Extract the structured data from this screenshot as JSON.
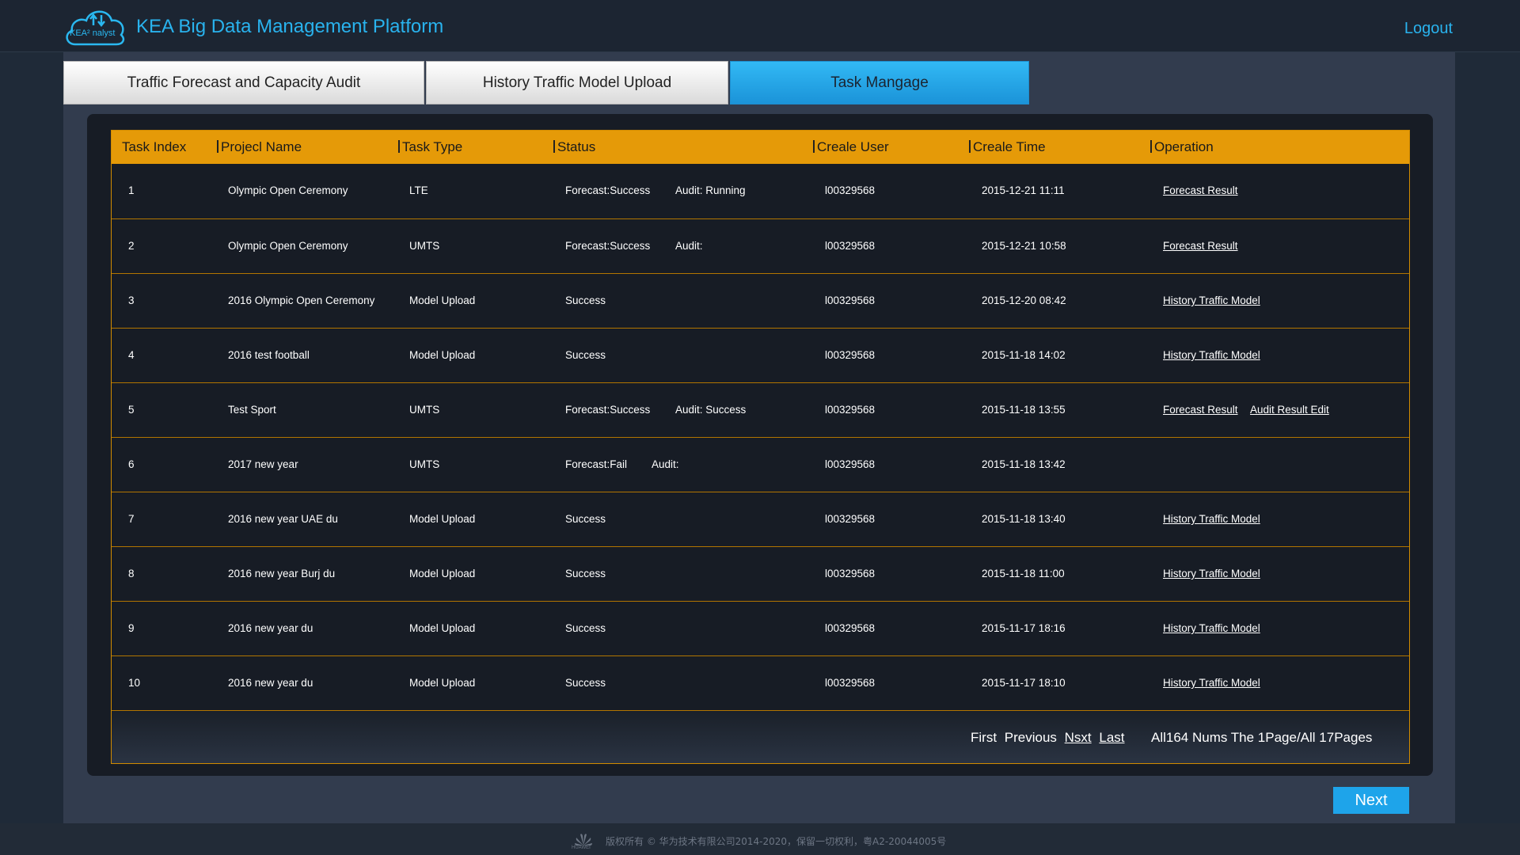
{
  "header": {
    "logo_text": "KEA² nalyst",
    "title": "KEA Big Data Management Platform",
    "logout": "Logout"
  },
  "tabs": [
    {
      "label": "Traffic Forecast and Capacity Audit",
      "active": false
    },
    {
      "label": "History Traffic Model Upload",
      "active": false
    },
    {
      "label": "Task Mangage",
      "active": true
    }
  ],
  "table": {
    "headers": [
      "Task Index",
      "Projecl Name",
      "Task Type",
      "Status",
      "Creale User",
      "Creale Time",
      "Operation"
    ],
    "rows": [
      {
        "index": "1",
        "project": "Olympic Open Ceremony",
        "type": "LTE",
        "status": "Forecast:Success",
        "audit": "Audit: Running",
        "user": "l00329568",
        "time": "2015-12-21 11:11",
        "op1": "Forecast Result",
        "op2": ""
      },
      {
        "index": "2",
        "project": "Olympic Open Ceremony",
        "type": "UMTS",
        "status": "Forecast:Success",
        "audit": "Audit:",
        "user": "l00329568",
        "time": "2015-12-21 10:58",
        "op1": "Forecast Result",
        "op2": ""
      },
      {
        "index": "3",
        "project": "2016 Olympic Open Ceremony",
        "type": "Model Upload",
        "status": "Success",
        "audit": "",
        "user": "l00329568",
        "time": "2015-12-20 08:42",
        "op1": "History Traffic Model",
        "op2": ""
      },
      {
        "index": "4",
        "project": "2016 test football",
        "type": "Model Upload",
        "status": "Success",
        "audit": "",
        "user": "l00329568",
        "time": "2015-11-18 14:02",
        "op1": "History Traffic Model",
        "op2": ""
      },
      {
        "index": "5",
        "project": "Test Sport",
        "type": "UMTS",
        "status": "Forecast:Success",
        "audit": "Audit: Success",
        "user": "l00329568",
        "time": "2015-11-18 13:55",
        "op1": "Forecast Result",
        "op2": "Audit Result Edit"
      },
      {
        "index": "6",
        "project": "2017 new year",
        "type": "UMTS",
        "status": "Forecast:Fail",
        "audit": "Audit:",
        "user": "l00329568",
        "time": "2015-11-18 13:42",
        "op1": "",
        "op2": ""
      },
      {
        "index": "7",
        "project": "2016 new year UAE du",
        "type": "Model Upload",
        "status": "Success",
        "audit": "",
        "user": "l00329568",
        "time": "2015-11-18 13:40",
        "op1": "History Traffic Model",
        "op2": ""
      },
      {
        "index": "8",
        "project": "2016 new year Burj du",
        "type": "Model Upload",
        "status": "Success",
        "audit": "",
        "user": "l00329568",
        "time": "2015-11-18 11:00",
        "op1": "History Traffic Model",
        "op2": ""
      },
      {
        "index": "9",
        "project": "2016 new year du",
        "type": "Model Upload",
        "status": "Success",
        "audit": "",
        "user": "l00329568",
        "time": "2015-11-17 18:16",
        "op1": "History Traffic Model",
        "op2": ""
      },
      {
        "index": "10",
        "project": "2016 new year du",
        "type": "Model Upload",
        "status": "Success",
        "audit": "",
        "user": "l00329568",
        "time": "2015-11-17 18:10",
        "op1": "History Traffic Model",
        "op2": ""
      }
    ]
  },
  "pager": {
    "first": "First",
    "previous": "Previous",
    "next": "Nsxt",
    "last": "Last",
    "info": "All164 Nums The 1Page/All 17Pages"
  },
  "next_button": "Next",
  "footer": {
    "logo_text": "HUAWEI",
    "copyright": "版权所有 © 华为技术有限公司2014-2020，保留一切权利，粤A2-20044005号"
  },
  "colors": {
    "accent": "#29b3ee",
    "header_row": "#e59a08",
    "active_tab": "#1ea4ea"
  }
}
